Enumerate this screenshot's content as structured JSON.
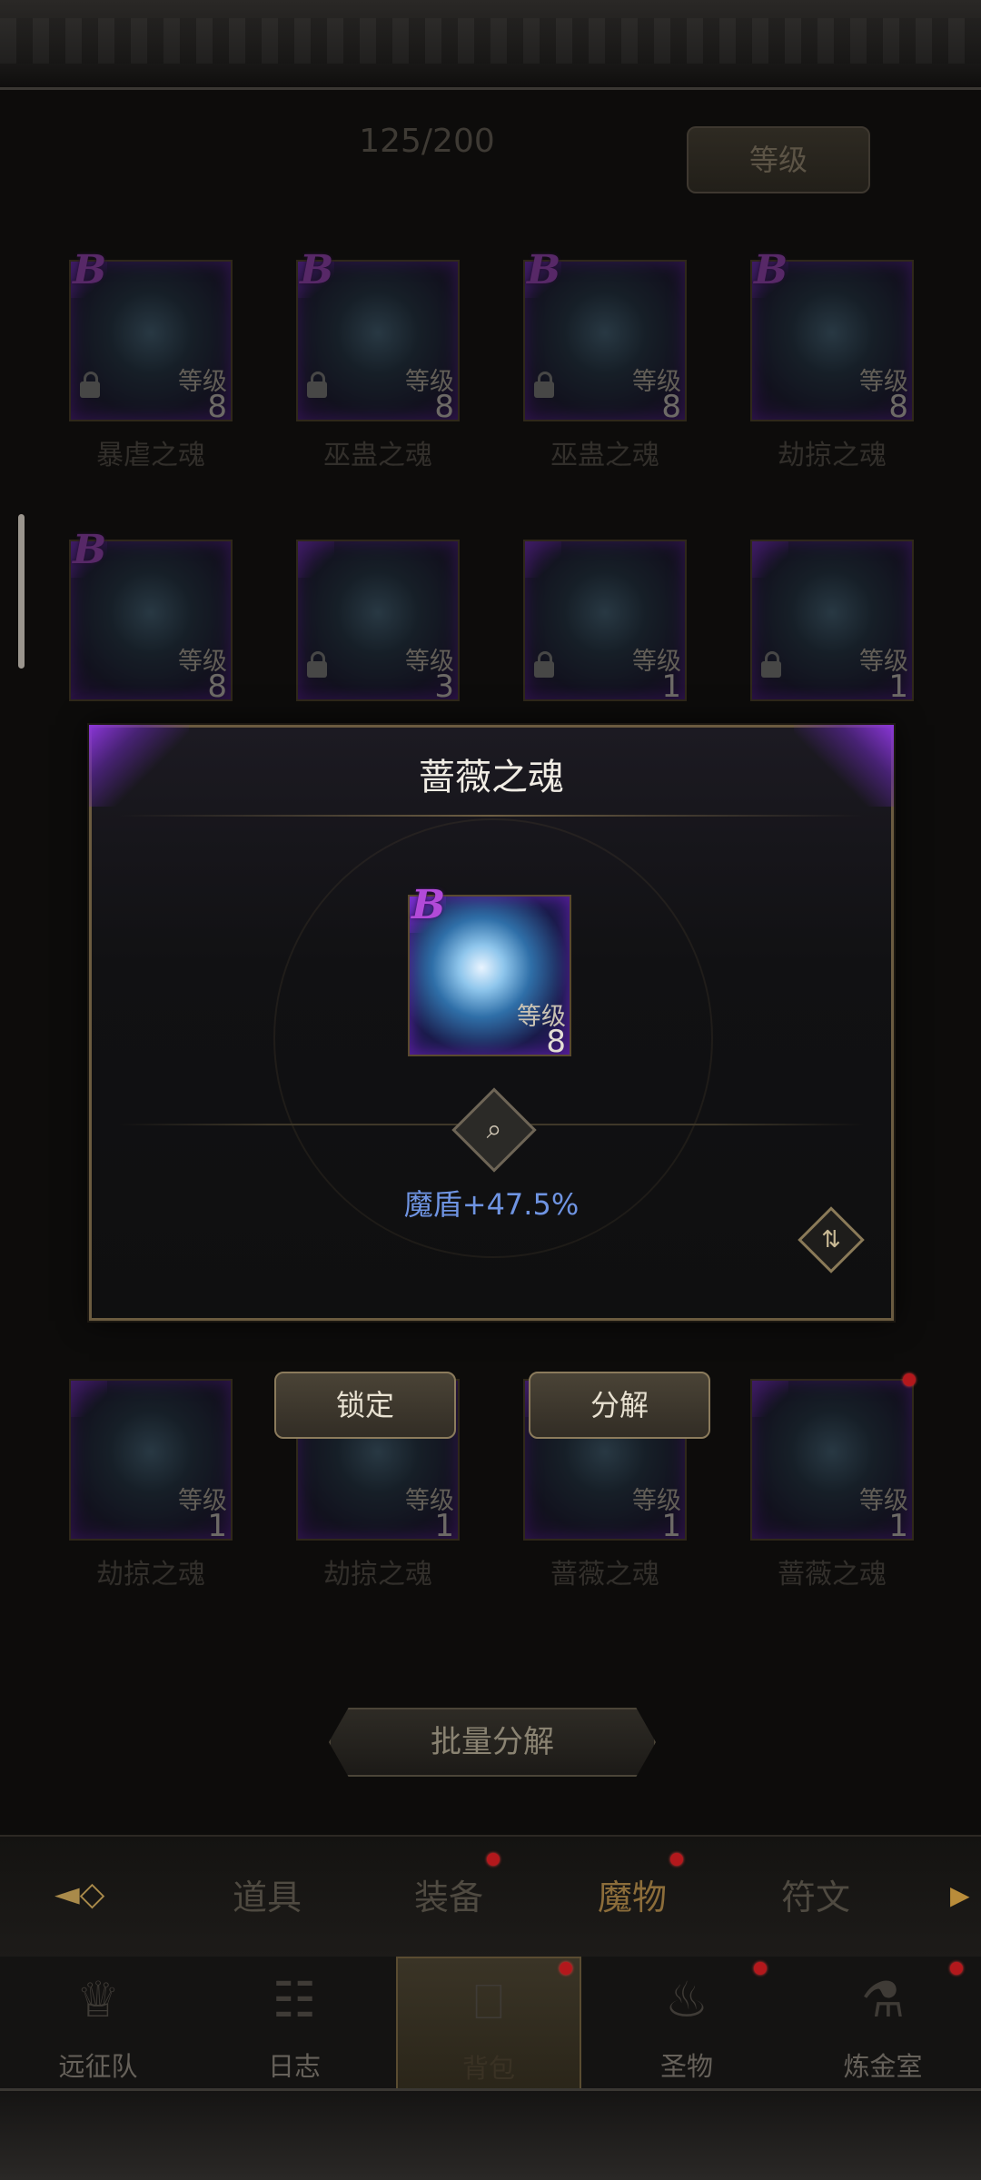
{
  "inventory": {
    "count": "125/200",
    "sort_label": "等级"
  },
  "grid": {
    "row1": [
      {
        "grade": "B",
        "level_label": "等级",
        "level": "8",
        "name": "暴虐之魂"
      },
      {
        "grade": "B",
        "level_label": "等级",
        "level": "8",
        "name": "巫蛊之魂"
      },
      {
        "grade": "B",
        "level_label": "等级",
        "level": "8",
        "name": "巫蛊之魂"
      },
      {
        "grade": "B",
        "level_label": "等级",
        "level": "8",
        "name": "劫掠之魂"
      }
    ],
    "row2": [
      {
        "grade": "B",
        "level_label": "等级",
        "level": "8"
      },
      {
        "level_label": "等级",
        "level": "3"
      },
      {
        "level_label": "等级",
        "level": "1"
      },
      {
        "level_label": "等级",
        "level": "1"
      }
    ],
    "row_bottom": [
      {
        "level_label": "等级",
        "level": "1",
        "name": "劫掠之魂"
      },
      {
        "level_label": "等级",
        "level": "1",
        "name": "劫掠之魂"
      },
      {
        "level_label": "等级",
        "level": "1",
        "name": "蔷薇之魂"
      },
      {
        "level_label": "等级",
        "level": "1",
        "name": "蔷薇之魂"
      }
    ]
  },
  "detail": {
    "title": "蔷薇之魂",
    "grade": "B",
    "level_label": "等级",
    "level": "8",
    "effect": "魔盾+47.5%",
    "inspect_icon": "magnifier-icon",
    "swap_icon": "swap-icon"
  },
  "actions": {
    "lock": "锁定",
    "decompose": "分解",
    "bulk_decompose": "批量分解"
  },
  "tabs": [
    {
      "label": "道具",
      "badge": false
    },
    {
      "label": "装备",
      "badge": true
    },
    {
      "label": "魔物",
      "badge": true,
      "active": true
    },
    {
      "label": "符文",
      "badge": false
    }
  ],
  "nav": [
    {
      "label": "远征队",
      "icon": "helmet-icon"
    },
    {
      "label": "日志",
      "icon": "scroll-icon"
    },
    {
      "label": "背包",
      "icon": "backpack-icon",
      "active": true
    },
    {
      "label": "圣物",
      "icon": "chalice-icon"
    },
    {
      "label": "炼金室",
      "icon": "alchemy-icon"
    }
  ],
  "colors": {
    "accent_gold": "#8b7b5c",
    "grade_purple": "#b24ad8",
    "effect_blue": "#6f94e2",
    "badge_red": "#b3181c"
  }
}
